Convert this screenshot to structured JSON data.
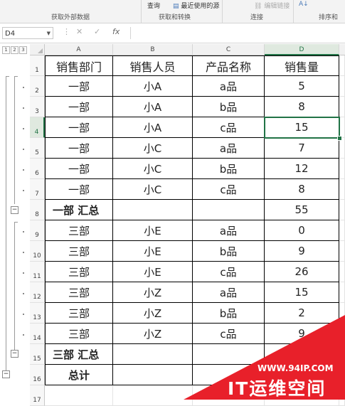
{
  "ribbon": {
    "group_external": "获取外部数据",
    "item_query": "查询",
    "item_recent": "最近使用的源",
    "group_transform": "获取和转换",
    "item_editlinks": "编辑链接",
    "group_connect": "连接",
    "group_sort": "排序和",
    "az_icon": "A↓"
  },
  "formula_bar": {
    "name_box": "D4",
    "fx": "fx",
    "content": ""
  },
  "outline_levels": [
    "1",
    "2",
    "3"
  ],
  "columns": [
    "A",
    "B",
    "C",
    "D"
  ],
  "rows": [
    {
      "n": "1",
      "a": "销售部门",
      "b": "销售人员",
      "c": "产品名称",
      "d": "销售量"
    },
    {
      "n": "2",
      "a": "一部",
      "b": "小A",
      "c": "a品",
      "d": "5"
    },
    {
      "n": "3",
      "a": "一部",
      "b": "小A",
      "c": "b品",
      "d": "8"
    },
    {
      "n": "4",
      "a": "一部",
      "b": "小A",
      "c": "c品",
      "d": "15"
    },
    {
      "n": "5",
      "a": "一部",
      "b": "小C",
      "c": "a品",
      "d": "7"
    },
    {
      "n": "6",
      "a": "一部",
      "b": "小C",
      "c": "b品",
      "d": "12"
    },
    {
      "n": "7",
      "a": "一部",
      "b": "小C",
      "c": "c品",
      "d": "8"
    },
    {
      "n": "8",
      "a": "一部 汇总",
      "b": "",
      "c": "",
      "d": "55"
    },
    {
      "n": "9",
      "a": "三部",
      "b": "小E",
      "c": "a品",
      "d": "0"
    },
    {
      "n": "10",
      "a": "三部",
      "b": "小E",
      "c": "b品",
      "d": "9"
    },
    {
      "n": "11",
      "a": "三部",
      "b": "小E",
      "c": "c品",
      "d": "26"
    },
    {
      "n": "12",
      "a": "三部",
      "b": "小Z",
      "c": "a品",
      "d": "15"
    },
    {
      "n": "13",
      "a": "三部",
      "b": "小Z",
      "c": "b品",
      "d": "2"
    },
    {
      "n": "14",
      "a": "三部",
      "b": "小Z",
      "c": "c品",
      "d": "9"
    },
    {
      "n": "15",
      "a": "三部 汇总",
      "b": "",
      "c": "",
      "d": ""
    },
    {
      "n": "16",
      "a": "总计",
      "b": "",
      "c": "",
      "d": ""
    },
    {
      "n": "17",
      "a": "",
      "b": "",
      "c": "",
      "d": ""
    }
  ],
  "collapse_symbol": "−",
  "selected_cell": "D4",
  "accent_color": "#217346",
  "watermark": {
    "url": "WWW.94IP.COM",
    "name": "IT运维空间",
    "color": "#e8202a"
  }
}
